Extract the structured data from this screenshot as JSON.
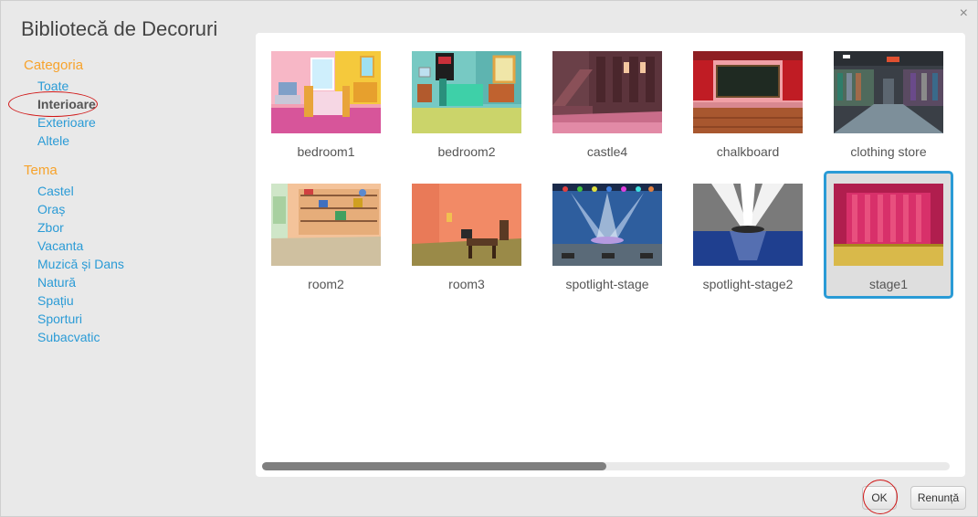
{
  "dialog": {
    "title": "Bibliotecă de Decoruri",
    "close_icon": "×"
  },
  "sidebar": {
    "category_title": "Categoria",
    "categories": [
      "Toate",
      "Interioare",
      "Exterioare",
      "Altele"
    ],
    "selected_category": "Interioare",
    "theme_title": "Tema",
    "themes": [
      "Castel",
      "Oraș",
      "Zbor",
      "Vacanta",
      "Muzică și Dans",
      "Natură",
      "Spațiu",
      "Sporturi",
      "Subacvatic"
    ]
  },
  "tiles": [
    {
      "label": "bedroom1"
    },
    {
      "label": "bedroom2"
    },
    {
      "label": "castle4"
    },
    {
      "label": "chalkboard"
    },
    {
      "label": "clothing store"
    },
    {
      "label": "room2"
    },
    {
      "label": "room3"
    },
    {
      "label": "spotlight-stage"
    },
    {
      "label": "spotlight-stage2"
    },
    {
      "label": "stage1",
      "selected": true
    }
  ],
  "scrollbar": {
    "position_fraction": 0.0,
    "visible_fraction": 0.5
  },
  "buttons": {
    "ok": "OK",
    "cancel": "Renunță"
  },
  "colors": {
    "accent": "#2a9bd6",
    "section": "#f7a32c",
    "annotation": "#d01818"
  }
}
